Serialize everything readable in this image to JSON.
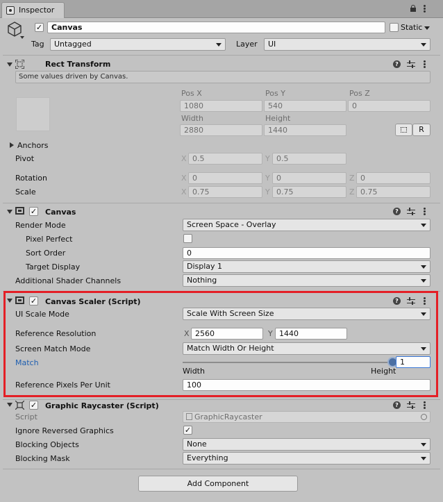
{
  "tab": {
    "title": "Inspector"
  },
  "object": {
    "name": "Canvas",
    "static_label": "Static",
    "tag_label": "Tag",
    "tag_value": "Untagged",
    "layer_label": "Layer",
    "layer_value": "UI"
  },
  "rect_transform": {
    "title": "Rect Transform",
    "note": "Some values driven by Canvas.",
    "pos_x_label": "Pos X",
    "pos_y_label": "Pos Y",
    "pos_z_label": "Pos Z",
    "pos_x": "1080",
    "pos_y": "540",
    "pos_z": "0",
    "width_label": "Width",
    "height_label": "Height",
    "width": "2880",
    "height": "1440",
    "r_button": "R",
    "anchors_label": "Anchors",
    "pivot_label": "Pivot",
    "pivot_x": "0.5",
    "pivot_y": "0.5",
    "rotation_label": "Rotation",
    "rot_x": "0",
    "rot_y": "0",
    "rot_z": "0",
    "scale_label": "Scale",
    "scale_x": "0.75",
    "scale_y": "0.75",
    "scale_z": "0.75",
    "axis_x": "X",
    "axis_y": "Y",
    "axis_z": "Z"
  },
  "canvas": {
    "title": "Canvas",
    "render_mode_label": "Render Mode",
    "render_mode": "Screen Space - Overlay",
    "pixel_perfect_label": "Pixel Perfect",
    "sort_order_label": "Sort Order",
    "sort_order": "0",
    "target_display_label": "Target Display",
    "target_display": "Display 1",
    "shader_channels_label": "Additional Shader Channels",
    "shader_channels": "Nothing"
  },
  "canvas_scaler": {
    "title": "Canvas Scaler (Script)",
    "ui_scale_mode_label": "UI Scale Mode",
    "ui_scale_mode": "Scale With Screen Size",
    "ref_res_label": "Reference Resolution",
    "ref_res_x": "2560",
    "ref_res_y": "1440",
    "match_mode_label": "Screen Match Mode",
    "match_mode": "Match Width Or Height",
    "match_label": "Match",
    "match_value": "1",
    "match_fraction": 1,
    "width_caption": "Width",
    "height_caption": "Height",
    "ppu_label": "Reference Pixels Per Unit",
    "ppu": "100"
  },
  "raycaster": {
    "title": "Graphic Raycaster (Script)",
    "script_label": "Script",
    "script_value": "GraphicRaycaster",
    "ignore_reversed_label": "Ignore Reversed Graphics",
    "blocking_objects_label": "Blocking Objects",
    "blocking_objects": "None",
    "blocking_mask_label": "Blocking Mask",
    "blocking_mask": "Everything"
  },
  "add_component": "Add Component",
  "colors": {
    "highlight": "#e41f26",
    "background": "#c2c2c2"
  }
}
